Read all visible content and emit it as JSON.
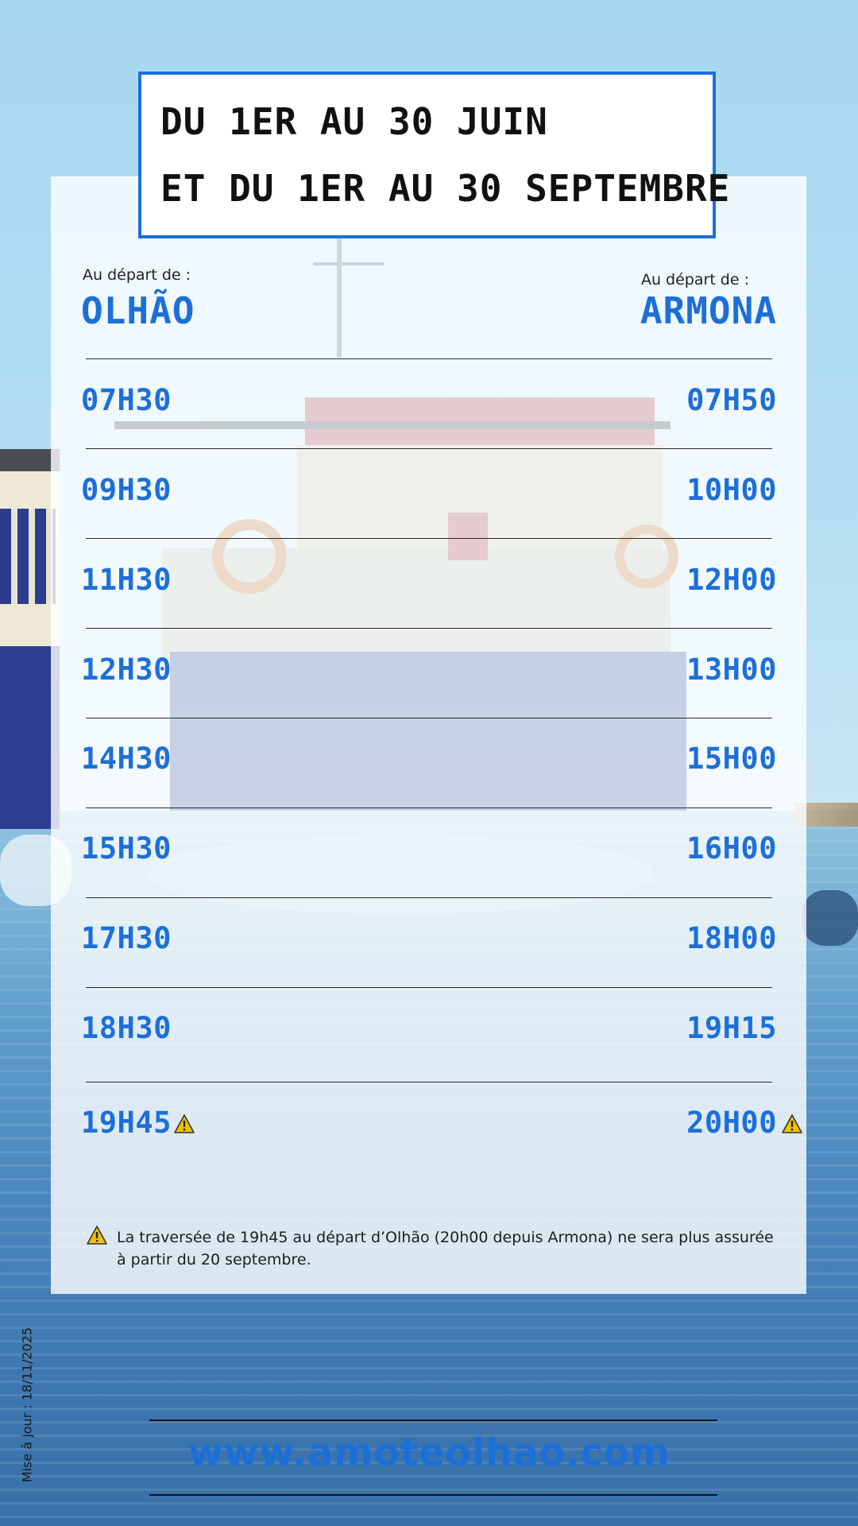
{
  "title": {
    "line1": "DU 1ER AU 30 JUIN",
    "line2": "ET DU 1ER AU 30 SEPTEMBRE"
  },
  "departures": {
    "left": {
      "label": "Au départ de :",
      "city": "OLHÃO"
    },
    "right": {
      "label": "Au départ de :",
      "city": "ARMONA"
    }
  },
  "schedule": [
    {
      "olhao": "07H30",
      "armona": "07H50"
    },
    {
      "olhao": "09H30",
      "armona": "10H00"
    },
    {
      "olhao": "11H30",
      "armona": "12H00"
    },
    {
      "olhao": "12H30",
      "armona": "13H00"
    },
    {
      "olhao": "14H30",
      "armona": "15H00"
    },
    {
      "olhao": "15H30",
      "armona": "16H00"
    },
    {
      "olhao": "17H30",
      "armona": "18H00"
    },
    {
      "olhao": "18H30",
      "armona": "19H15"
    },
    {
      "olhao": "19H45",
      "armona": "20H00",
      "warning": true
    }
  ],
  "note": "La traversée de 19h45 au départ d’Olhão (20h00 depuis Armona) ne sera plus assurée à partir du 20 septembre.",
  "icons": {
    "warning": "warning-triangle-icon"
  },
  "colors": {
    "accent": "#1d6fd8",
    "warning": "#f2c200"
  },
  "footer": {
    "website": "www.amoteolhao.com",
    "updated": "Mise à jour : 18/11/2025"
  }
}
